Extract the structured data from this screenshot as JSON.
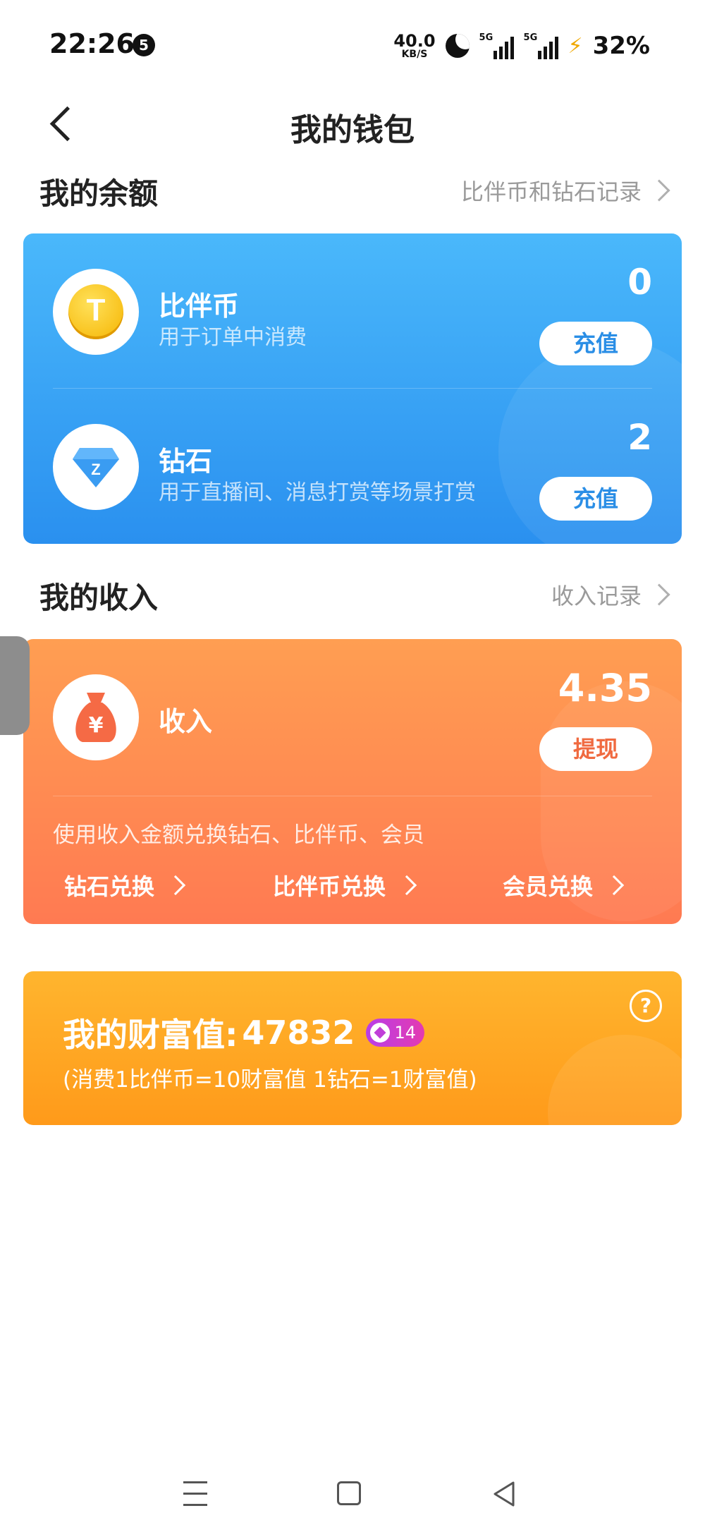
{
  "status_bar": {
    "time": "22:26",
    "notification_count": "5",
    "net_speed_value": "40.0",
    "net_speed_unit": "KB/S",
    "signal1_tag": "5G",
    "signal2_tag": "5G",
    "battery": "32%"
  },
  "header": {
    "title": "我的钱包"
  },
  "balance_section": {
    "title": "我的余额",
    "record_link": "比伴币和钻石记录"
  },
  "balance_items": [
    {
      "name": "比伴币",
      "desc": "用于订单中消费",
      "value": "0",
      "button": "充值",
      "icon": "coin-icon"
    },
    {
      "name": "钻石",
      "desc": "用于直播间、消息打赏等场景打赏",
      "value": "2",
      "button": "充值",
      "icon": "diamond-icon"
    }
  ],
  "income_section": {
    "title": "我的收入",
    "record_link": "收入记录"
  },
  "income": {
    "name": "收入",
    "value": "4.35",
    "button": "提现",
    "desc": "使用收入金额兑换钻石、比伴币、会员",
    "exchanges": [
      "钻石兑换",
      "比伴币兑换",
      "会员兑换"
    ]
  },
  "wealth": {
    "label": "我的财富值:",
    "value": "47832",
    "level": "14",
    "note": "(消费1比伴币=10财富值 1钻石=1财富值)",
    "help": "?"
  },
  "colors": {
    "blue_card": "#3aa4f6",
    "orange_card": "#ff8a52",
    "gold_card": "#ffa824",
    "battery_bolt": "#f0a800"
  }
}
